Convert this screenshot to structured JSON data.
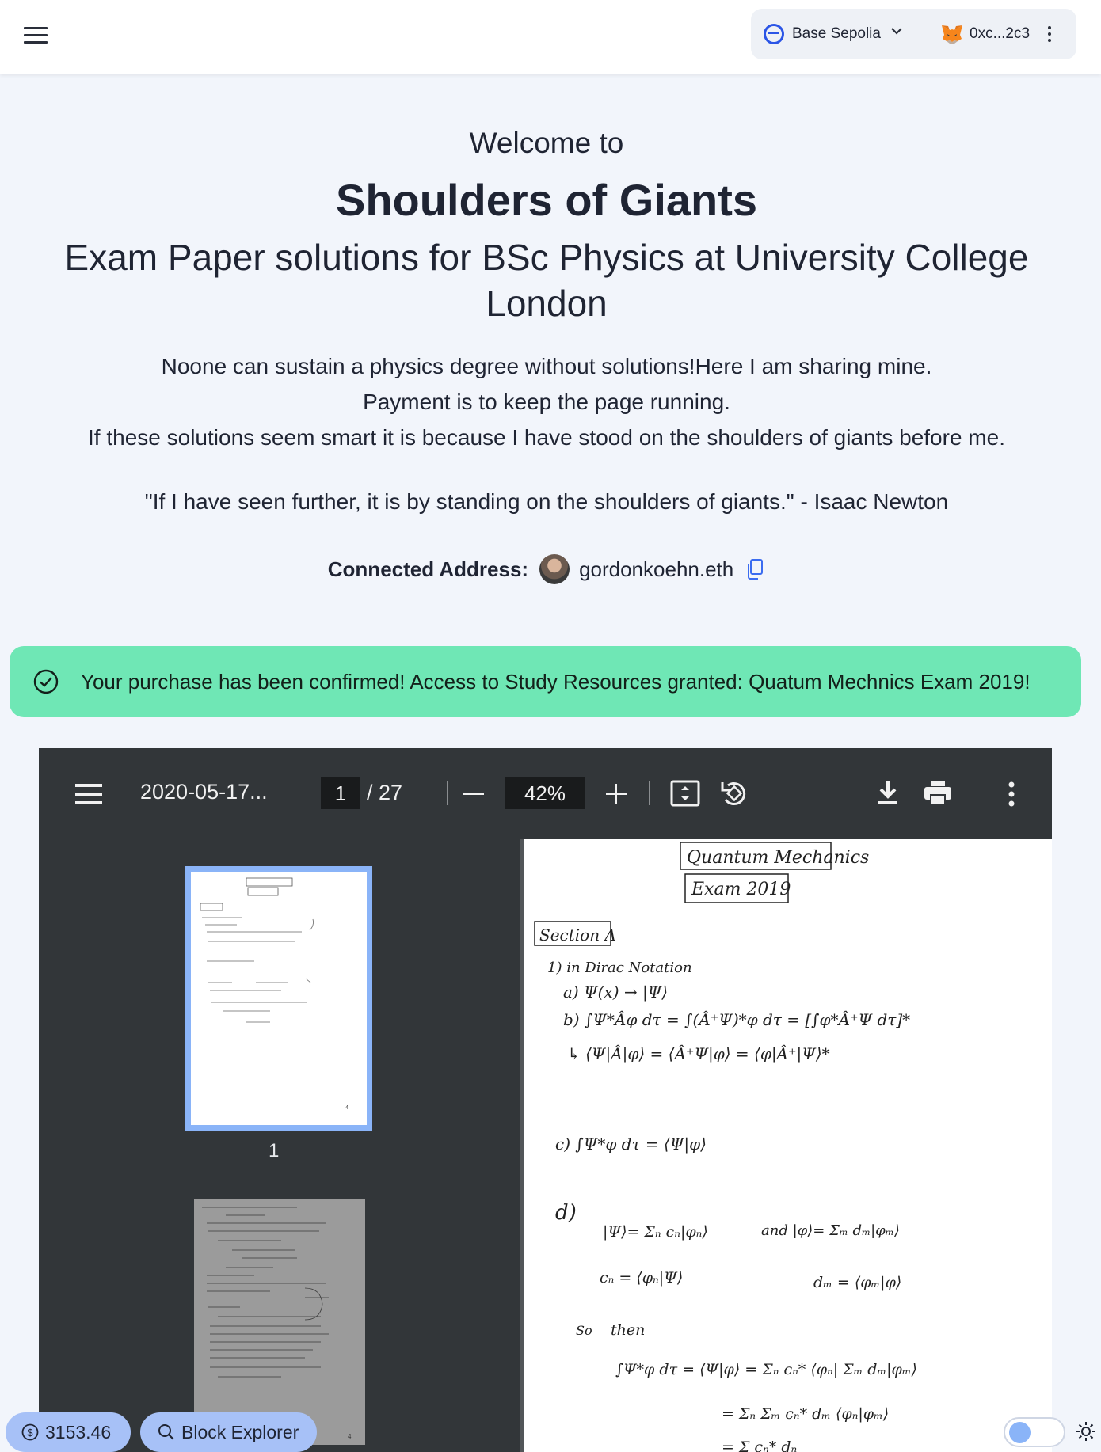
{
  "nav": {
    "network_label": "Base Sepolia",
    "account_label": "0xc...2c3"
  },
  "hero": {
    "welcome": "Welcome to",
    "brand": "Shoulders of Giants",
    "subtitle": "Exam Paper solutions for BSc Physics at University College London",
    "desc_line1": "Noone can sustain a physics degree without solutions!Here I am sharing mine.",
    "desc_line2": "Payment is to keep the page running.",
    "desc_line3": "If these solutions seem smart it is because I have stood on the shoulders of giants before me.",
    "quote": "\"If I have seen further, it is by standing on the shoulders of giants.\" - Isaac Newton",
    "connected_label": "Connected Address:",
    "connected_address": "gordonkoehn.eth"
  },
  "alert": {
    "message": "Your purchase has been confirmed! Access to Study Resources granted: Quatum Mechnics Exam 2019!",
    "color": "#6fe7b5"
  },
  "pdf": {
    "filename": "2020-05-17...",
    "current_page": "1",
    "total_pages": "/ 27",
    "zoom": "42%",
    "thumbnail_label": "1",
    "page_heading": "Quantum Mechanics",
    "page_subheading": "Exam 2019",
    "section_label": "Section A",
    "icons": [
      "menu-icon",
      "zoom-out-icon",
      "zoom-in-icon",
      "fit-page-icon",
      "rotate-icon",
      "download-icon",
      "print-icon",
      "more-icon"
    ]
  },
  "footer": {
    "balance": "3153.46",
    "explorer_label": "Block Explorer"
  },
  "colors": {
    "accent": "#2b55e6",
    "pill": "#a7c1f7",
    "background": "#f2f5fb",
    "viewer_toolbar": "#323639"
  }
}
